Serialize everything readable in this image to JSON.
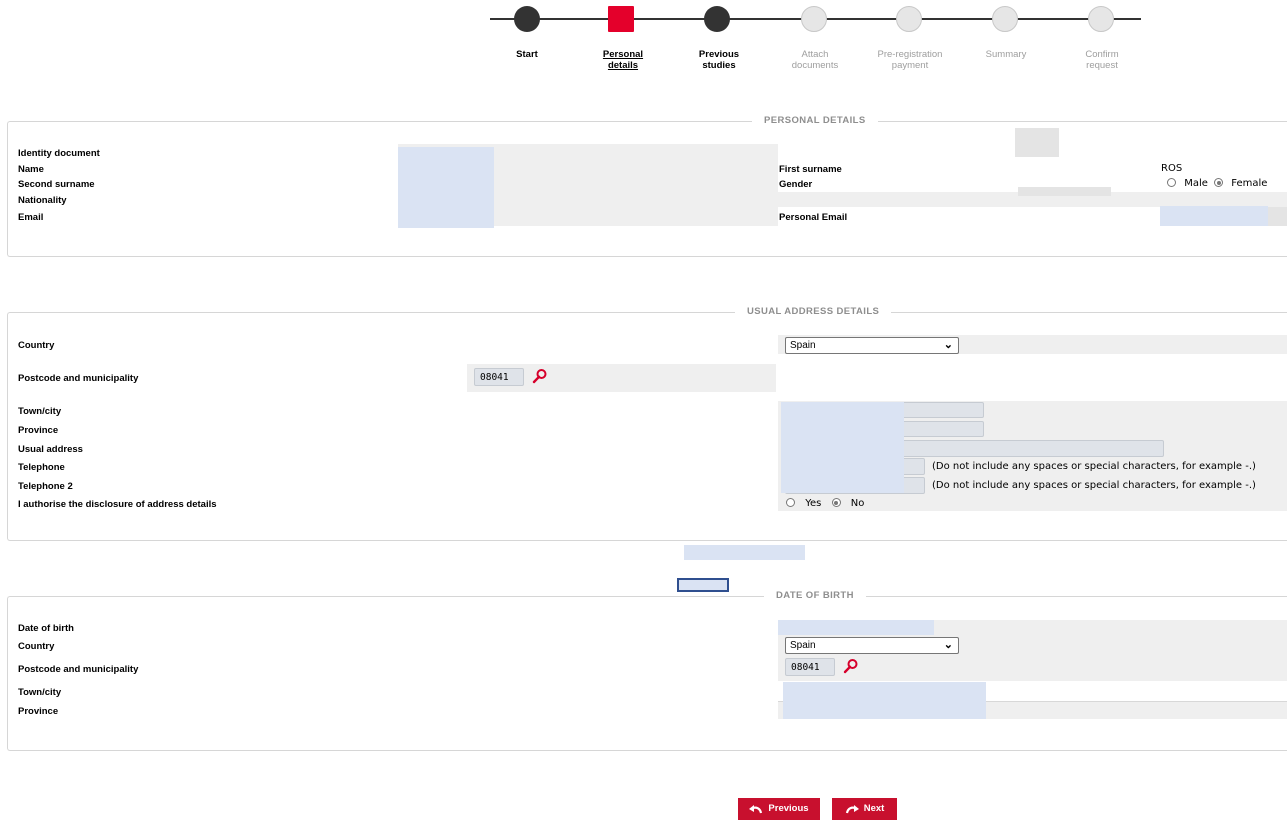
{
  "stepper": {
    "steps": [
      {
        "label": "Start",
        "state": "done"
      },
      {
        "label": "Personal\ndetails",
        "state": "current"
      },
      {
        "label": "Previous\nstudies",
        "state": "done"
      },
      {
        "label": "Attach\ndocuments",
        "state": "pending"
      },
      {
        "label": "Pre-registration\npayment",
        "state": "pending"
      },
      {
        "label": "Summary",
        "state": "pending"
      },
      {
        "label": "Confirm\nrequest",
        "state": "pending"
      }
    ]
  },
  "personal": {
    "legend": "PERSONAL DETAILS",
    "identity_label": "Identity document",
    "name_label": "Name",
    "second_surname_label": "Second surname",
    "nationality_label": "Nationality",
    "email_label": "Email",
    "first_surname_label": "First surname",
    "first_surname_value": "ROS",
    "gender_label": "Gender",
    "gender_male": "Male",
    "gender_female": "Female",
    "gender_selected": "Female",
    "personal_email_label": "Personal Email"
  },
  "address": {
    "legend": "USUAL ADDRESS DETAILS",
    "country_label": "Country",
    "country_value": "Spain",
    "postcode_label": "Postcode and municipality",
    "postcode_value": "08041",
    "town_label": "Town/city",
    "province_label": "Province",
    "usual_address_label": "Usual address",
    "telephone_label": "Telephone",
    "telephone2_label": "Telephone 2",
    "phone_hint": "(Do not include any spaces or special characters, for example -.)",
    "disclosure_label": "I authorise the disclosure of address details",
    "yes_label": "Yes",
    "no_label": "No",
    "disclosure_selected": "No"
  },
  "birth": {
    "legend": "DATE OF BIRTH",
    "date_label": "Date of birth",
    "country_label": "Country",
    "country_value": "Spain",
    "postcode_label": "Postcode and municipality",
    "postcode_value": "08041",
    "town_label": "Town/city",
    "province_label": "Province"
  },
  "nav": {
    "previous_label": "Previous",
    "next_label": "Next"
  },
  "colors": {
    "accent": "#e4002b",
    "button": "#c8102e",
    "redaction": "#dae3f3"
  }
}
